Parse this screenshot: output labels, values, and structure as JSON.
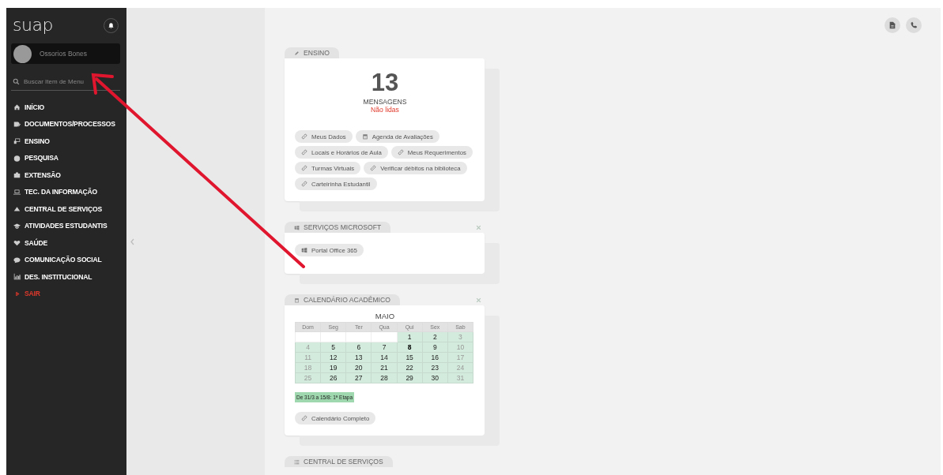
{
  "sidebar": {
    "logo": "suap",
    "user": {
      "name": "Ossorios Bones"
    },
    "search": {
      "placeholder": "Buscar Item de Menu"
    },
    "menu": [
      {
        "label": "INÍCIO",
        "kind": "section"
      },
      {
        "label": "DOCUMENTOS/PROCESSOS",
        "kind": "section"
      },
      {
        "label": "ENSINO",
        "kind": "section"
      },
      {
        "label": "PESQUISA",
        "kind": "section"
      },
      {
        "label": "EXTENSÃO",
        "kind": "section"
      },
      {
        "label": "TEC. DA INFORMAÇÃO",
        "kind": "section"
      },
      {
        "label": "CENTRAL DE SERVIÇOS",
        "kind": "section"
      },
      {
        "label": "ATIVIDADES ESTUDANTIS",
        "kind": "section"
      },
      {
        "label": "SAÚDE",
        "kind": "section"
      },
      {
        "label": "COMUNICAÇÃO SOCIAL",
        "kind": "section"
      },
      {
        "label": "DES. INSTITUCIONAL",
        "kind": "section"
      },
      {
        "label": "SAIR",
        "kind": "exit"
      }
    ]
  },
  "toolbar": {
    "buttons": [
      {
        "kind": "document"
      },
      {
        "kind": "phone"
      }
    ]
  },
  "widgets": [
    {
      "kind": "messages",
      "title": "ENSINO",
      "closable": false,
      "count": "13",
      "count_label": "MENSAGENS",
      "count_sublabel": "Não lidas",
      "links": [
        {
          "label": "Meus Dados",
          "kind": "link"
        },
        {
          "label": "Agenda de Avaliações",
          "kind": "calendar"
        },
        {
          "label": "Locais e Horários de Aula",
          "kind": "link"
        },
        {
          "label": "Meus Requerimentos",
          "kind": "link"
        },
        {
          "label": "Turmas Virtuais",
          "kind": "link"
        },
        {
          "label": "Verificar débitos na biblioteca",
          "kind": "link"
        },
        {
          "label": "Carteirinha Estudantil",
          "kind": "link"
        }
      ]
    },
    {
      "kind": "links",
      "title": "SERVIÇOS MICROSOFT",
      "closable": true,
      "links": [
        {
          "label": "Portal Office 365",
          "kind": "windows"
        }
      ]
    },
    {
      "kind": "calendar",
      "title": "CALENDÁRIO ACADÊMICO",
      "closable": true,
      "month": "MAIO",
      "weekdays": [
        "Dom",
        "Seg",
        "Ter",
        "Qua",
        "Qui",
        "Sex",
        "Sab"
      ],
      "weeks": [
        [
          {
            "kind": "blank"
          },
          {
            "kind": "blank"
          },
          {
            "kind": "blank"
          },
          {
            "kind": "blank"
          },
          {
            "kind": "day",
            "day": "1",
            "dimmed": false,
            "today": false
          },
          {
            "kind": "day",
            "day": "2",
            "dimmed": false,
            "today": false
          },
          {
            "kind": "day",
            "day": "3",
            "dimmed": true,
            "today": false
          }
        ],
        [
          {
            "kind": "day",
            "day": "4",
            "dimmed": true,
            "today": false
          },
          {
            "kind": "day",
            "day": "5",
            "dimmed": false,
            "today": false
          },
          {
            "kind": "day",
            "day": "6",
            "dimmed": false,
            "today": false
          },
          {
            "kind": "day",
            "day": "7",
            "dimmed": false,
            "today": false
          },
          {
            "kind": "day",
            "day": "8",
            "dimmed": false,
            "today": true
          },
          {
            "kind": "day",
            "day": "9",
            "dimmed": false,
            "today": false
          },
          {
            "kind": "day",
            "day": "10",
            "dimmed": true,
            "today": false
          }
        ],
        [
          {
            "kind": "day",
            "day": "11",
            "dimmed": true,
            "today": false
          },
          {
            "kind": "day",
            "day": "12",
            "dimmed": false,
            "today": false
          },
          {
            "kind": "day",
            "day": "13",
            "dimmed": false,
            "today": false
          },
          {
            "kind": "day",
            "day": "14",
            "dimmed": false,
            "today": false
          },
          {
            "kind": "day",
            "day": "15",
            "dimmed": false,
            "today": false
          },
          {
            "kind": "day",
            "day": "16",
            "dimmed": false,
            "today": false
          },
          {
            "kind": "day",
            "day": "17",
            "dimmed": true,
            "today": false
          }
        ],
        [
          {
            "kind": "day",
            "day": "18",
            "dimmed": true,
            "today": false
          },
          {
            "kind": "day",
            "day": "19",
            "dimmed": false,
            "today": false
          },
          {
            "kind": "day",
            "day": "20",
            "dimmed": false,
            "today": false
          },
          {
            "kind": "day",
            "day": "21",
            "dimmed": false,
            "today": false
          },
          {
            "kind": "day",
            "day": "22",
            "dimmed": false,
            "today": false
          },
          {
            "kind": "day",
            "day": "23",
            "dimmed": false,
            "today": false
          },
          {
            "kind": "day",
            "day": "24",
            "dimmed": true,
            "today": false
          }
        ],
        [
          {
            "kind": "day",
            "day": "25",
            "dimmed": true,
            "today": false
          },
          {
            "kind": "day",
            "day": "26",
            "dimmed": false,
            "today": false
          },
          {
            "kind": "day",
            "day": "27",
            "dimmed": false,
            "today": false
          },
          {
            "kind": "day",
            "day": "28",
            "dimmed": false,
            "today": false
          },
          {
            "kind": "day",
            "day": "29",
            "dimmed": false,
            "today": false
          },
          {
            "kind": "day",
            "day": "30",
            "dimmed": false,
            "today": false
          },
          {
            "kind": "day",
            "day": "31",
            "dimmed": true,
            "today": false
          }
        ]
      ],
      "legend": [
        {
          "label": "De 31/3 a 15/8: 1ª Etapa"
        }
      ],
      "links": [
        {
          "label": "Calendário Completo",
          "kind": "link"
        }
      ]
    },
    {
      "kind": "header_only",
      "title": "CENTRAL DE SERVIÇOS",
      "closable": false
    }
  ],
  "annotation": {
    "kind": "arrow"
  }
}
